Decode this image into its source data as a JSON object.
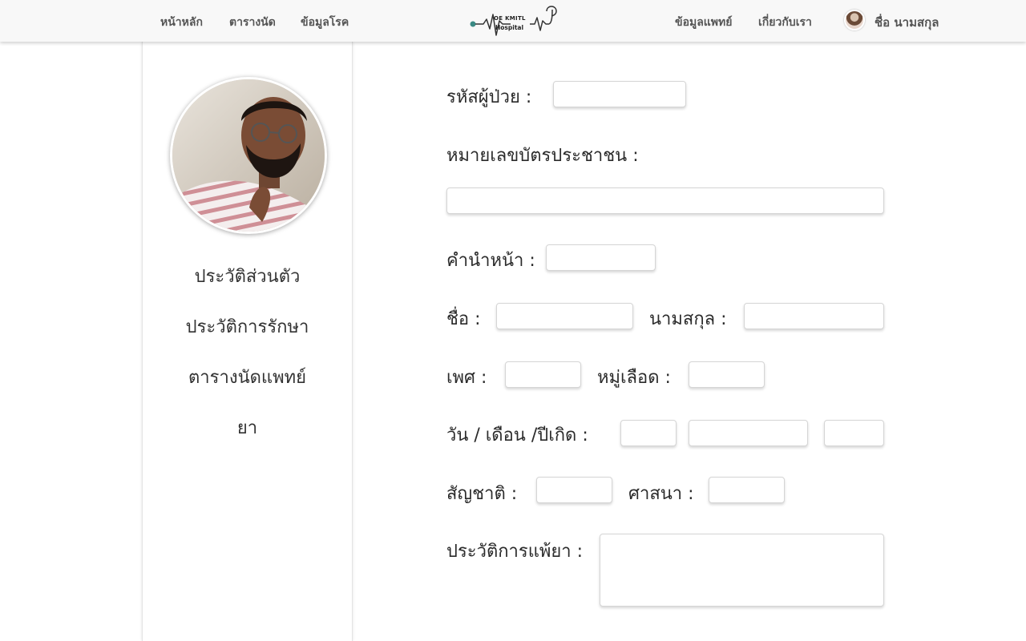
{
  "nav": {
    "left_links": [
      "หน้าหลัก",
      "ตารางนัด",
      "ข้อมูลโรค"
    ],
    "right_links": [
      "ข้อมูลแพทย์",
      "เกี่ยวกับเรา"
    ],
    "user_name": "ชื่อ นามสกุล",
    "logo_line1": "OE KMITL",
    "logo_line2": "Hospital"
  },
  "sidebar": {
    "items": [
      "ประวัติส่วนตัว",
      "ประวัติการรักษา",
      "ตารางนัดแพทย์",
      "ยา"
    ]
  },
  "form": {
    "patient_id_label": "รหัสผู้ป่วย :",
    "national_id_label": "หมายเลขบัตรประชาชน :",
    "prefix_label": "คำนำหน้า :",
    "first_name_label": "ชื่อ :",
    "last_name_label": "นามสกุล :",
    "gender_label": "เพศ :",
    "blood_type_label": "หมู่เลือด :",
    "birth_date_label": "วัน / เดือน /ปีเกิด :",
    "nationality_label": "สัญชาติ :",
    "religion_label": "ศาสนา :",
    "allergy_label": "ประวัติการแพ้ยา :",
    "values": {
      "patient_id": "",
      "national_id": "",
      "prefix": "",
      "first_name": "",
      "last_name": "",
      "gender": "",
      "blood_type": "",
      "birth_day": "",
      "birth_month": "",
      "birth_year": "",
      "nationality": "",
      "religion": "",
      "allergy": ""
    }
  },
  "colors": {
    "topbar_bg": "#f8f8f8",
    "nav_text": "#555555",
    "logo_accent": "#3a8a84"
  }
}
